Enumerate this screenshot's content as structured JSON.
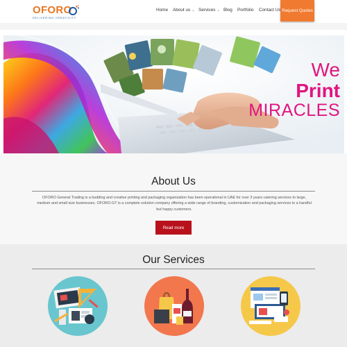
{
  "brand": {
    "name": "OFORO",
    "tagline": "DELIVERING CREATIVITY",
    "colors": {
      "orange": "#e87722",
      "blue": "#1a5aa6",
      "red": "#b8111c"
    }
  },
  "nav": {
    "items": [
      {
        "label": "Home"
      },
      {
        "label": "About us",
        "has_dropdown": true
      },
      {
        "label": "Services",
        "has_dropdown": true
      },
      {
        "label": "Blog"
      },
      {
        "label": "Portfolio"
      },
      {
        "label": "Contact Us"
      }
    ],
    "cta_label": "Request Quotes"
  },
  "hero": {
    "line1": "We",
    "line2": "Print",
    "line3": "MIRACLES"
  },
  "about": {
    "title": "About Us",
    "text": "OFORO General Trading is a budding and creative printing and packaging organization has been operational in UAE for over 3 years catering services to large, medium and small size businesses. OFORO-GT is a complete solution company offering a wide range of branding, customization and packaging services to a handful but happy customers.",
    "button_label": "Read more"
  },
  "services": {
    "title": "Our Services",
    "items": [
      {
        "icon": "design-tools-icon",
        "color": "#69c6cf"
      },
      {
        "icon": "packaging-icon",
        "color": "#f2774d"
      },
      {
        "icon": "web-devices-icon",
        "color": "#f6c84a"
      }
    ]
  }
}
